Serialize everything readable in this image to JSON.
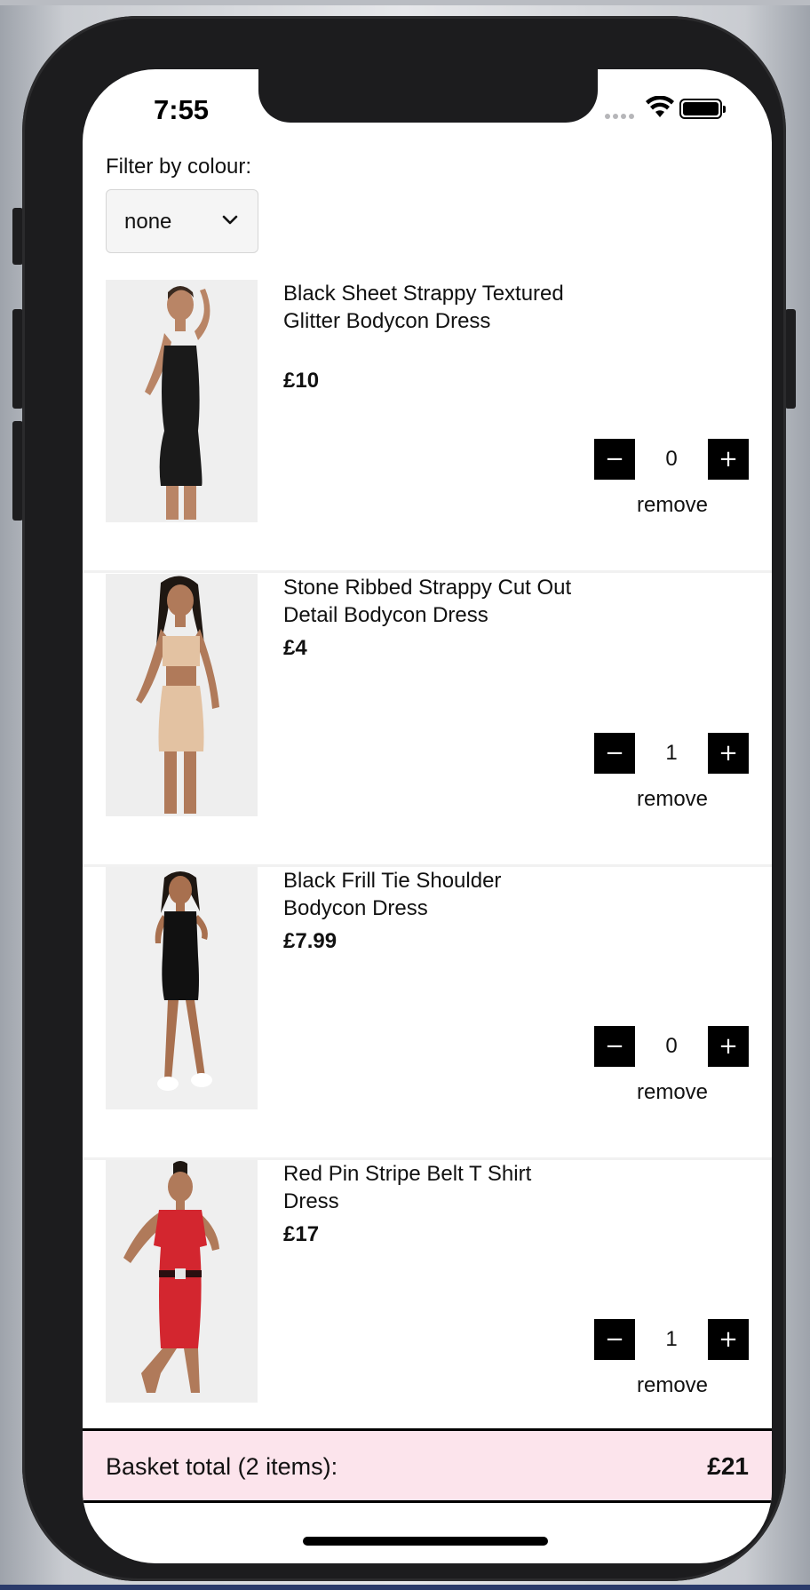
{
  "status_bar": {
    "time": "7:55",
    "icons": [
      "cellular-dots-icon",
      "wifi-icon",
      "battery-icon"
    ]
  },
  "filter": {
    "label": "Filter by colour:",
    "selected": "none"
  },
  "products": [
    {
      "name": "Black Sheet Strappy Textured Glitter Bodycon Dress",
      "price": "£10",
      "quantity": "0",
      "remove_label": "remove",
      "dress_color": "#1a1a1a"
    },
    {
      "name": "Stone Ribbed Strappy Cut Out Detail Bodycon Dress",
      "price": "£4",
      "quantity": "1",
      "remove_label": "remove",
      "dress_color": "#e3c2a2"
    },
    {
      "name": "Black Frill Tie Shoulder Bodycon Dress",
      "price": "£7.99",
      "quantity": "0",
      "remove_label": "remove",
      "dress_color": "#111111"
    },
    {
      "name": "Red Pin Stripe Belt T Shirt Dress",
      "price": "£17",
      "quantity": "1",
      "remove_label": "remove",
      "dress_color": "#d3262f"
    }
  ],
  "quantity_buttons": {
    "minus": "−",
    "plus": "+"
  },
  "basket": {
    "label": "Basket total (2 items):",
    "total": "£21",
    "background": "#fce4ec"
  }
}
